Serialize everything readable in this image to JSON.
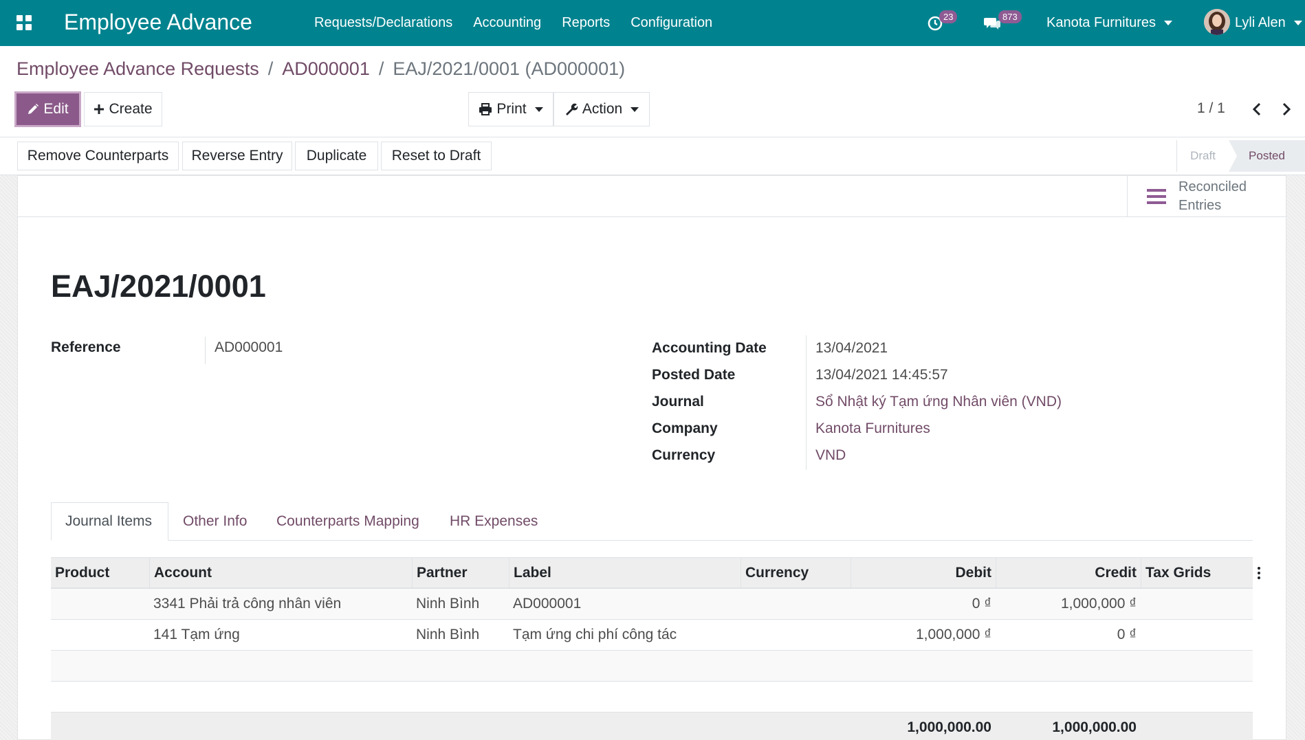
{
  "navbar": {
    "app_title": "Employee Advance",
    "menu": [
      {
        "label": "Requests/Declarations"
      },
      {
        "label": "Accounting"
      },
      {
        "label": "Reports"
      },
      {
        "label": "Configuration"
      }
    ],
    "activity_count": "23",
    "messages_count": "873",
    "company": "Kanota Furnitures",
    "user_name": "Lyli Alen",
    "theme_color": "#00838f"
  },
  "breadcrumb": {
    "items": [
      "Employee Advance Requests",
      "AD000001"
    ],
    "separator": "/",
    "current": "EAJ/2021/0001 (AD000001)"
  },
  "control_panel": {
    "edit_label": "Edit",
    "create_label": "Create",
    "print_label": "Print",
    "action_label": "Action",
    "pager_value": "1 / 1"
  },
  "statusbar": {
    "buttons": [
      "Remove Counterparts",
      "Reverse Entry",
      "Duplicate",
      "Reset to Draft"
    ],
    "stages": {
      "draft": "Draft",
      "posted": "Posted"
    },
    "active_stage": "Posted"
  },
  "smart_button": {
    "line1": "Reconciled",
    "line2": "Entries"
  },
  "record": {
    "title": "EAJ/2021/0001",
    "reference_label": "Reference",
    "reference_value": "AD000001",
    "fields": {
      "accounting_date": {
        "label": "Accounting Date",
        "value": "13/04/2021"
      },
      "posted_date": {
        "label": "Posted Date",
        "value": "13/04/2021 14:45:57"
      },
      "journal": {
        "label": "Journal",
        "value": "Sổ Nhật ký Tạm ứng Nhân viên (VND)"
      },
      "company": {
        "label": "Company",
        "value": "Kanota Furnitures"
      },
      "currency": {
        "label": "Currency",
        "value": "VND"
      }
    }
  },
  "tabs": [
    {
      "label": "Journal Items",
      "active": true
    },
    {
      "label": "Other Info"
    },
    {
      "label": "Counterparts Mapping"
    },
    {
      "label": "HR Expenses"
    }
  ],
  "table": {
    "columns": [
      "Product",
      "Account",
      "Partner",
      "Label",
      "Currency",
      "Debit",
      "Credit",
      "Tax Grids"
    ],
    "rows": [
      {
        "product": "",
        "account": "3341 Phải trả công nhân viên",
        "partner": "Ninh Bình",
        "label": "AD000001",
        "currency": "",
        "debit": "0 ₫",
        "credit": "1,000,000 ₫",
        "tax_grids": ""
      },
      {
        "product": "",
        "account": "141 Tạm ứng",
        "partner": "Ninh Bình",
        "label": "Tạm ứng chi phí công tác",
        "currency": "",
        "debit": "1,000,000 ₫",
        "credit": "0 ₫",
        "tax_grids": ""
      }
    ],
    "totals": {
      "debit": "1,000,000.00",
      "credit": "1,000,000.00"
    }
  }
}
